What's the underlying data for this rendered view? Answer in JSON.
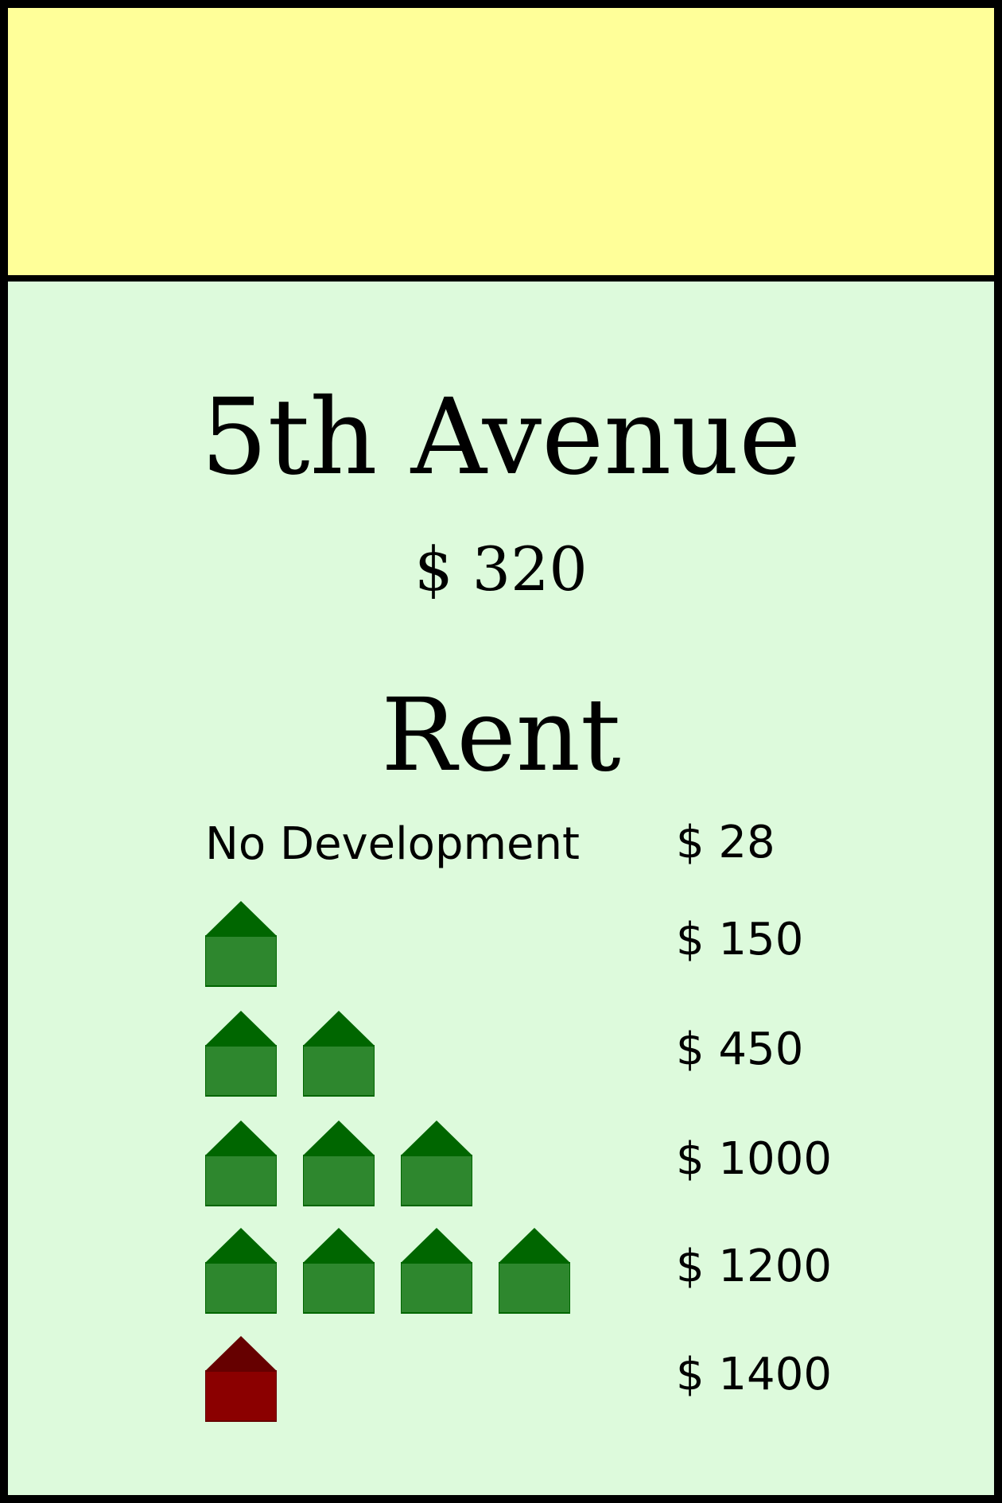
{
  "card": {
    "band_color": "#ffff99",
    "body_color": "#ddfadc",
    "title": "5th Avenue",
    "price": "$ 320",
    "rent_heading": "Rent"
  },
  "rent_rows": [
    {
      "level": "no-development",
      "label": "No Development",
      "amount": "$ 28",
      "houses": 0,
      "hotels": 0
    },
    {
      "level": "1-house",
      "label": "",
      "amount": "$ 150",
      "houses": 1,
      "hotels": 0
    },
    {
      "level": "2-houses",
      "label": "",
      "amount": "$ 450",
      "houses": 2,
      "hotels": 0
    },
    {
      "level": "3-houses",
      "label": "",
      "amount": "$ 1000",
      "houses": 3,
      "hotels": 0
    },
    {
      "level": "4-houses",
      "label": "",
      "amount": "$ 1200",
      "houses": 4,
      "hotels": 0
    },
    {
      "level": "hotel",
      "label": "",
      "amount": "$ 1400",
      "houses": 0,
      "hotels": 1
    }
  ],
  "colors": {
    "house_roof": "#006600",
    "house_body": "#2e872e",
    "hotel_roof": "#660000",
    "hotel_body": "#8b0000"
  },
  "icons": {
    "house": "house-icon",
    "hotel": "hotel-icon"
  }
}
